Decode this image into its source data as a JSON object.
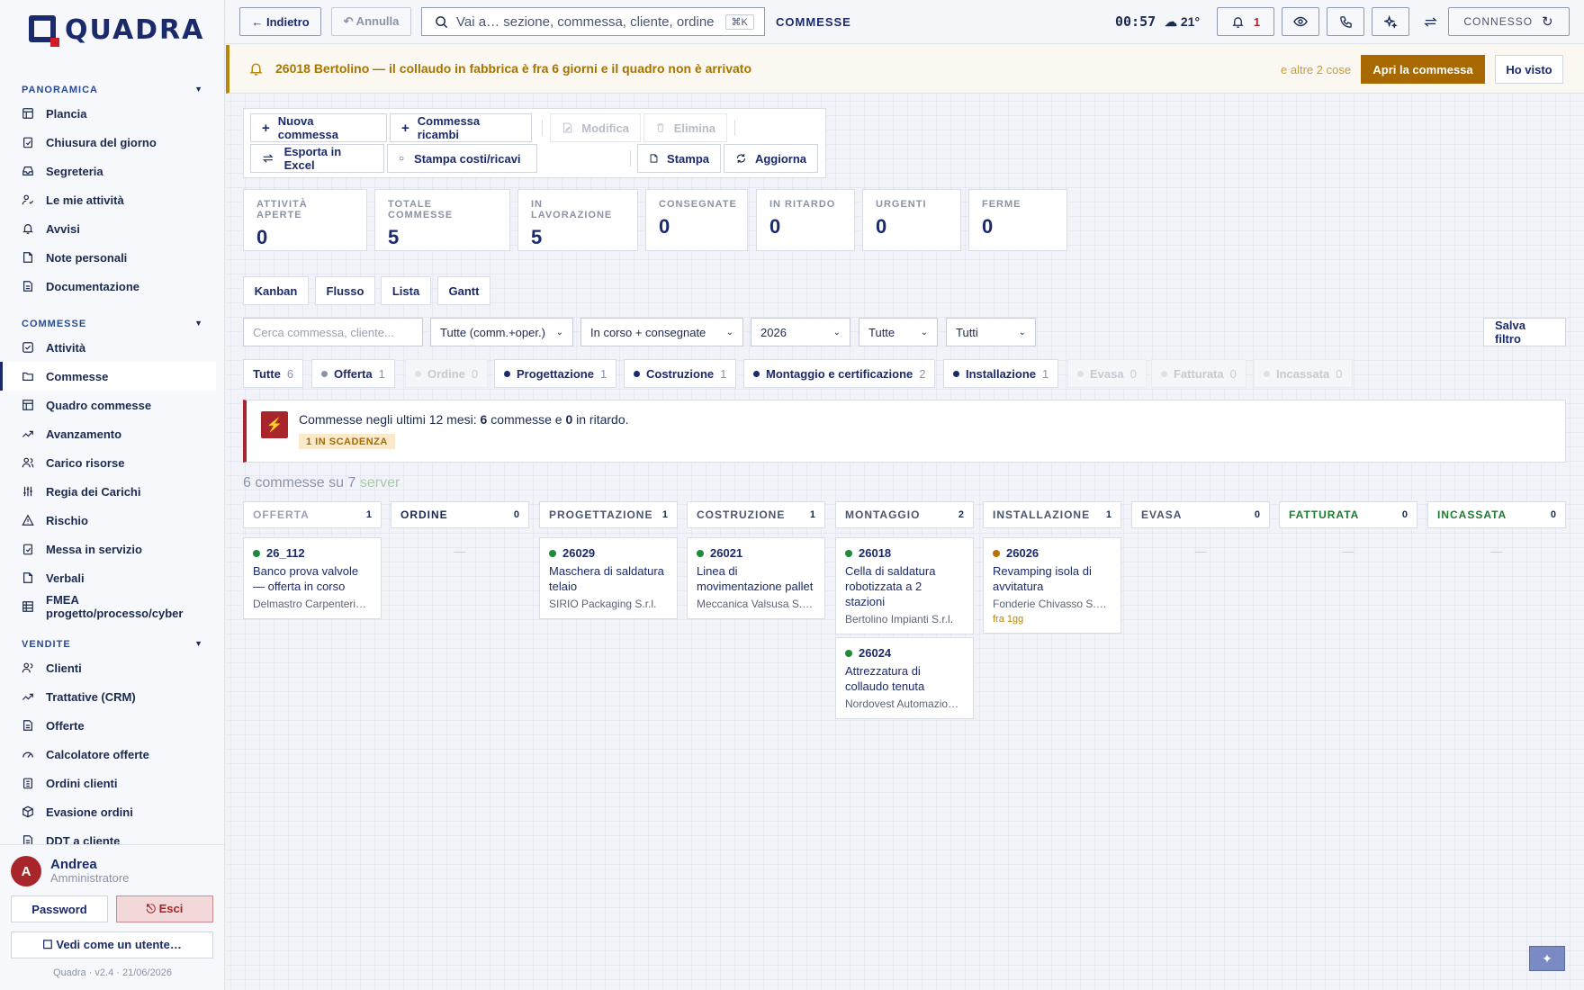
{
  "app": {
    "name": "QUADRA",
    "version": "Quadra · v2.4 · 21/06/2026"
  },
  "sidebar": {
    "sections": [
      {
        "title": "PANORAMICA",
        "items": [
          {
            "label": "Plancia",
            "icon": "layout-icon"
          },
          {
            "label": "Chiusura del giorno",
            "icon": "clipboard-check-icon"
          },
          {
            "label": "Segreteria",
            "icon": "inbox-icon"
          },
          {
            "label": "Le mie attività",
            "icon": "user-check-icon"
          },
          {
            "label": "Avvisi",
            "icon": "bell-icon"
          },
          {
            "label": "Note personali",
            "icon": "note-icon"
          },
          {
            "label": "Documentazione",
            "icon": "file-icon"
          }
        ]
      },
      {
        "title": "COMMESSE",
        "items": [
          {
            "label": "Attività",
            "icon": "check-square-icon"
          },
          {
            "label": "Commesse",
            "icon": "folder-icon",
            "active": true
          },
          {
            "label": "Quadro commesse",
            "icon": "table-icon"
          },
          {
            "label": "Avanzamento",
            "icon": "trend-icon"
          },
          {
            "label": "Carico risorse",
            "icon": "users-icon"
          },
          {
            "label": "Regia dei Carichi",
            "icon": "sliders-icon"
          },
          {
            "label": "Rischio",
            "icon": "warning-icon"
          },
          {
            "label": "Messa in servizio",
            "icon": "clipboard-check-icon"
          },
          {
            "label": "Verbali",
            "icon": "note-icon"
          },
          {
            "label": "FMEA progetto/processo/cyber",
            "icon": "table-icon"
          }
        ]
      },
      {
        "title": "VENDITE",
        "items": [
          {
            "label": "Clienti",
            "icon": "users-icon"
          },
          {
            "label": "Trattative (CRM)",
            "icon": "trend-icon"
          },
          {
            "label": "Offerte",
            "icon": "file-icon"
          },
          {
            "label": "Calcolatore offerte",
            "icon": "gauge-icon"
          },
          {
            "label": "Ordini clienti",
            "icon": "clipboard-icon"
          },
          {
            "label": "Evasione ordini",
            "icon": "box-icon"
          },
          {
            "label": "DDT a cliente",
            "icon": "file-icon"
          }
        ]
      }
    ],
    "caret": "▼"
  },
  "user": {
    "initial": "A",
    "name": "Andrea",
    "role": "Amministratore",
    "password_label": "Password",
    "logout_label": "⎋ Esci",
    "impersonate_label": "☐ Vedi come un utente…"
  },
  "topbar": {
    "back_label": "← Indietro",
    "undo_label": "↶ Annulla",
    "search_placeholder": "Vai a… sezione, commessa, cliente, ordine",
    "search_shortcut": "⌘K",
    "section": "COMMESSE",
    "clock": "00:57",
    "weather": "☁ 21°",
    "notif_count": "1",
    "connection": "CONNESSO"
  },
  "banner": {
    "message": "26018 Bertolino — il collaudo in fabbrica è fra 6 giorni e il quadro non è arrivato",
    "more": "e altre 2 cose",
    "open_label": "Apri la commessa",
    "seen_label": "Ho visto"
  },
  "actions": {
    "new": "Nuova commessa",
    "new_spare": "Commessa ricambi",
    "edit": "Modifica",
    "delete": "Elimina",
    "export": "Esporta in Excel",
    "print_costs": "Stampa costi/ricavi",
    "print": "Stampa",
    "refresh": "Aggiorna"
  },
  "stats": [
    {
      "label": "ATTIVITÀ APERTE",
      "value": "0"
    },
    {
      "label": "TOTALE COMMESSE",
      "value": "5"
    },
    {
      "label": "IN LAVORAZIONE",
      "value": "5"
    },
    {
      "label": "CONSEGNATE",
      "value": "0"
    },
    {
      "label": "IN RITARDO",
      "value": "0"
    },
    {
      "label": "URGENTI",
      "value": "0"
    },
    {
      "label": "FERME",
      "value": "0"
    }
  ],
  "views": [
    "Kanban",
    "Flusso",
    "Lista",
    "Gantt"
  ],
  "filters": {
    "search_placeholder": "Cerca commessa, cliente...",
    "type": "Tutte (comm.+oper.)",
    "state": "In corso + consegnate",
    "year": "2026",
    "f4": "Tutte",
    "f5": "Tutti",
    "save_label": "Salva filtro"
  },
  "chips": [
    {
      "label": "Tutte",
      "count": "6"
    },
    {
      "label": "Offerta",
      "count": "1"
    },
    {
      "label": "Ordine",
      "count": "0"
    },
    {
      "label": "Progettazione",
      "count": "1"
    },
    {
      "label": "Costruzione",
      "count": "1"
    },
    {
      "label": "Montaggio e certificazione",
      "count": "2"
    },
    {
      "label": "Installazione",
      "count": "1"
    },
    {
      "label": "Evasa",
      "count": "0"
    },
    {
      "label": "Fatturata",
      "count": "0"
    },
    {
      "label": "Incassata",
      "count": "0"
    }
  ],
  "alert": {
    "prefix": "Commesse negli ultimi 12 mesi: ",
    "n1": "6",
    "mid": " commesse e ",
    "n2": "0",
    "suffix": " in ritardo.",
    "badge": "1 IN SCADENZA"
  },
  "summary": {
    "text": "6 commesse su 7",
    "source": "server"
  },
  "kanban": {
    "empty": "—",
    "columns": [
      {
        "title": "OFFERTA",
        "count": "1"
      },
      {
        "title": "ORDINE",
        "count": "0"
      },
      {
        "title": "PROGETTAZIONE",
        "count": "1"
      },
      {
        "title": "COSTRUZIONE",
        "count": "1"
      },
      {
        "title": "MONTAGGIO",
        "count": "2"
      },
      {
        "title": "INSTALLAZIONE",
        "count": "1"
      },
      {
        "title": "EVASA",
        "count": "0"
      },
      {
        "title": "FATTURATA",
        "count": "0"
      },
      {
        "title": "INCASSATA",
        "count": "0"
      }
    ],
    "cards": [
      {
        "id": "26_112",
        "title": "Banco prova valvole — offerta in corso",
        "client": "Delmastro Carpenteria S.r.l."
      },
      {
        "id": "26029",
        "title": "Maschera di saldatura telaio",
        "client": "SIRIO Packaging S.r.l."
      },
      {
        "id": "26021",
        "title": "Linea di movimentazione pallet",
        "client": "Meccanica Valsusa S.p.A."
      },
      {
        "id": "26018",
        "title": "Cella di saldatura robotizzata a 2 stazioni",
        "client": "Bertolino Impianti S.r.l."
      },
      {
        "id": "26024",
        "title": "Attrezzatura di collaudo tenuta",
        "client": "Nordovest Automazione S.r.l."
      },
      {
        "id": "26026",
        "title": "Revamping isola di avvitatura",
        "client": "Fonderie Chivasso S.p.A.",
        "due": "fra 1gg"
      }
    ]
  },
  "colors": {
    "primary": "#1b2a6b",
    "accent": "#b8860b",
    "danger": "#a8252b",
    "ok": "#1e8a3a"
  }
}
